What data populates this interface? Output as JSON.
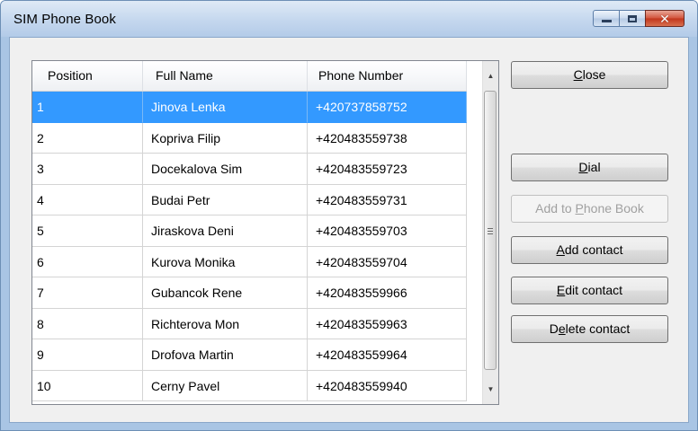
{
  "window": {
    "title": "SIM Phone Book"
  },
  "listview": {
    "columns": [
      "Position",
      "Full Name",
      "Phone Number"
    ],
    "rows": [
      {
        "position": "1",
        "name": "Jinova Lenka",
        "phone": "+420737858752",
        "selected": true
      },
      {
        "position": "2",
        "name": "Kopriva Filip",
        "phone": "+420483559738"
      },
      {
        "position": "3",
        "name": "Docekalova Sim",
        "phone": "+420483559723"
      },
      {
        "position": "4",
        "name": "Budai Petr",
        "phone": "+420483559731"
      },
      {
        "position": "5",
        "name": "Jiraskova Deni",
        "phone": "+420483559703"
      },
      {
        "position": "6",
        "name": "Kurova Monika",
        "phone": "+420483559704"
      },
      {
        "position": "7",
        "name": "Gubancok Rene",
        "phone": "+420483559966"
      },
      {
        "position": "8",
        "name": "Richterova Mon",
        "phone": "+420483559963"
      },
      {
        "position": "9",
        "name": "Drofova Martin",
        "phone": "+420483559964"
      },
      {
        "position": "10",
        "name": "Cerny Pavel",
        "phone": "+420483559940"
      }
    ]
  },
  "buttons": {
    "close": {
      "pre": "",
      "mnemonic": "C",
      "post": "lose"
    },
    "dial": {
      "pre": "",
      "mnemonic": "D",
      "post": "ial"
    },
    "add_to_phone_book": {
      "pre": "Add to ",
      "mnemonic": "P",
      "post": "hone Book",
      "enabled": false
    },
    "add_contact": {
      "pre": "",
      "mnemonic": "A",
      "post": "dd contact"
    },
    "edit_contact": {
      "pre": "",
      "mnemonic": "E",
      "post": "dit contact"
    },
    "delete_contact": {
      "pre": "D",
      "mnemonic": "e",
      "post": "lete contact"
    }
  },
  "icons": {
    "minimize": "minimize-icon",
    "maximize": "maximize-icon",
    "close": "close-icon",
    "scroll_up": "scroll-up-arrow-icon",
    "scroll_down": "scroll-down-arrow-icon"
  },
  "colors": {
    "selection": "#3399ff",
    "close_button": "#c1351c"
  }
}
